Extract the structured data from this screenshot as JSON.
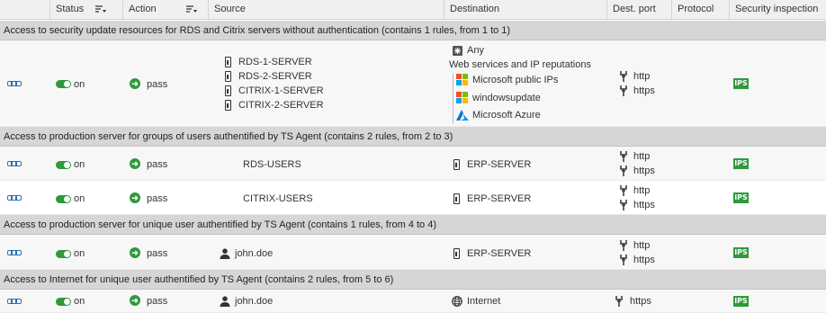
{
  "header": {
    "status": "Status",
    "action": "Action",
    "source": "Source",
    "destination": "Destination",
    "dest_port": "Dest. port",
    "protocol": "Protocol",
    "security_inspection": "Security inspection"
  },
  "groups": [
    "Access to security update resources for RDS and Citrix servers without authentication (contains 1 rules, from 1 to 1)",
    "Access to production server for groups of users authentified by TS Agent (contains 2 rules, from 2 to 3)",
    "Access to production server for unique user authentified by TS Agent (contains 1 rules, from 4 to 4)",
    "Access to Internet for unique user authentified by TS Agent (contains 2 rules, from 5 to 6)"
  ],
  "colors": {
    "green": "#2e9a3a",
    "blue": "#2b6fb8",
    "group_bg": "#d6d6d6"
  },
  "rules": [
    {
      "status": "on",
      "action": "pass",
      "sources": [
        "RDS-1-SERVER",
        "RDS-2-SERVER",
        "CITRIX-1-SERVER",
        "CITRIX-2-SERVER"
      ],
      "dest_any": "Any",
      "dest_category": "Web services and IP reputations",
      "destinations": [
        "Microsoft public IPs",
        "windowsupdate",
        "Microsoft Azure"
      ],
      "ports": [
        "http",
        "https"
      ],
      "inspection": "IPS"
    },
    {
      "status": "on",
      "action": "pass",
      "source": "RDS-USERS",
      "destination": "ERP-SERVER",
      "ports": [
        "http",
        "https"
      ],
      "inspection": "IPS"
    },
    {
      "status": "on",
      "action": "pass",
      "source": "CITRIX-USERS",
      "destination": "ERP-SERVER",
      "ports": [
        "http",
        "https"
      ],
      "inspection": "IPS"
    },
    {
      "status": "on",
      "action": "pass",
      "source": "john.doe",
      "destination": "ERP-SERVER",
      "ports": [
        "http",
        "https"
      ],
      "inspection": "IPS"
    },
    {
      "status": "on",
      "action": "pass",
      "source": "john.doe",
      "destination": "Internet",
      "ports": [
        "https"
      ],
      "inspection": "IPS"
    }
  ]
}
